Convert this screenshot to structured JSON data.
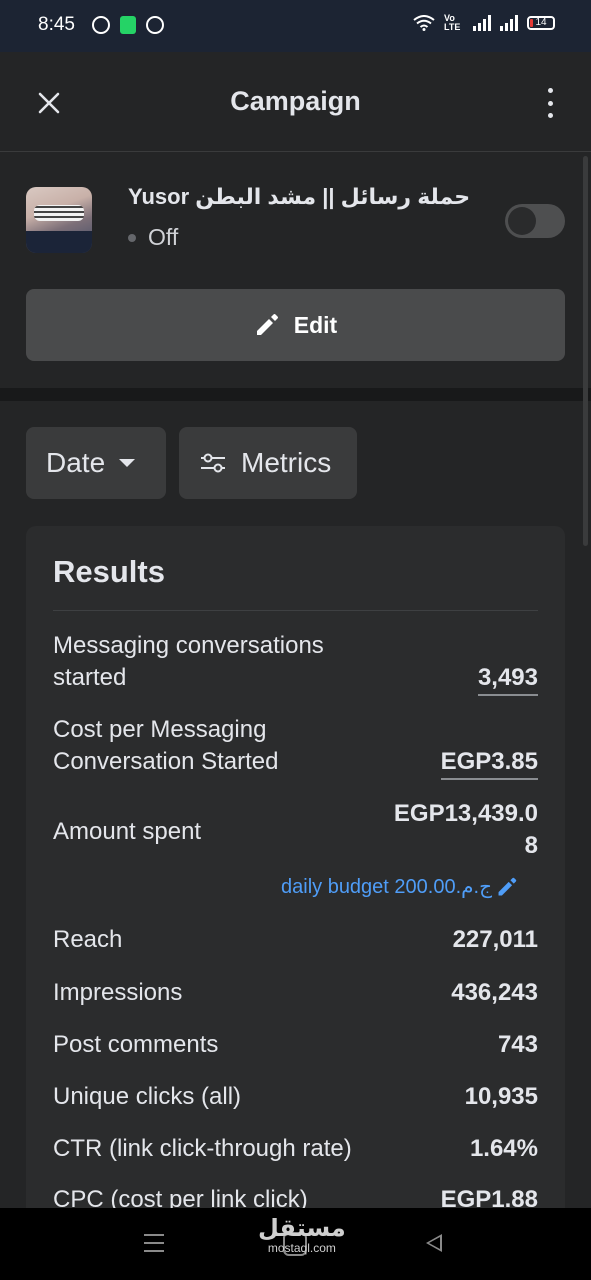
{
  "status_bar": {
    "time": "8:45",
    "network_label": "Vo LTE",
    "battery_level": "14",
    "battery_fraction": 0.14
  },
  "header": {
    "title": "Campaign",
    "close_icon": "close-icon",
    "more_icon": "more-vertical-icon"
  },
  "campaign": {
    "name": "Yusor حملة رسائل || مشد البطن",
    "status": "Off",
    "enabled": false,
    "edit_label": "Edit"
  },
  "filters": {
    "date_label": "Date",
    "metrics_label": "Metrics"
  },
  "results": {
    "title": "Results",
    "metrics": [
      {
        "label": "Messaging conversations started",
        "value": "3,493"
      },
      {
        "label": "Cost per Messaging Conversation Started",
        "value": "EGP3.85"
      },
      {
        "label": "Amount spent",
        "value": "EGP13,439.08"
      },
      {
        "label": "Reach",
        "value": "227,011"
      },
      {
        "label": "Impressions",
        "value": "436,243"
      },
      {
        "label": "Post comments",
        "value": "743"
      },
      {
        "label": "Unique clicks (all)",
        "value": "10,935"
      },
      {
        "label": "CTR (link click-through rate)",
        "value": "1.64%"
      },
      {
        "label": "CPC (cost per link click)",
        "value": "EGP1.88"
      }
    ],
    "budget_text": "daily budget 200.00.ج.م"
  },
  "watermark": {
    "arabic": "مستقل",
    "latin": "mostaql.com"
  },
  "colors": {
    "background": "#242526",
    "link": "#4f9df7",
    "status_bar": "#1c2433"
  }
}
